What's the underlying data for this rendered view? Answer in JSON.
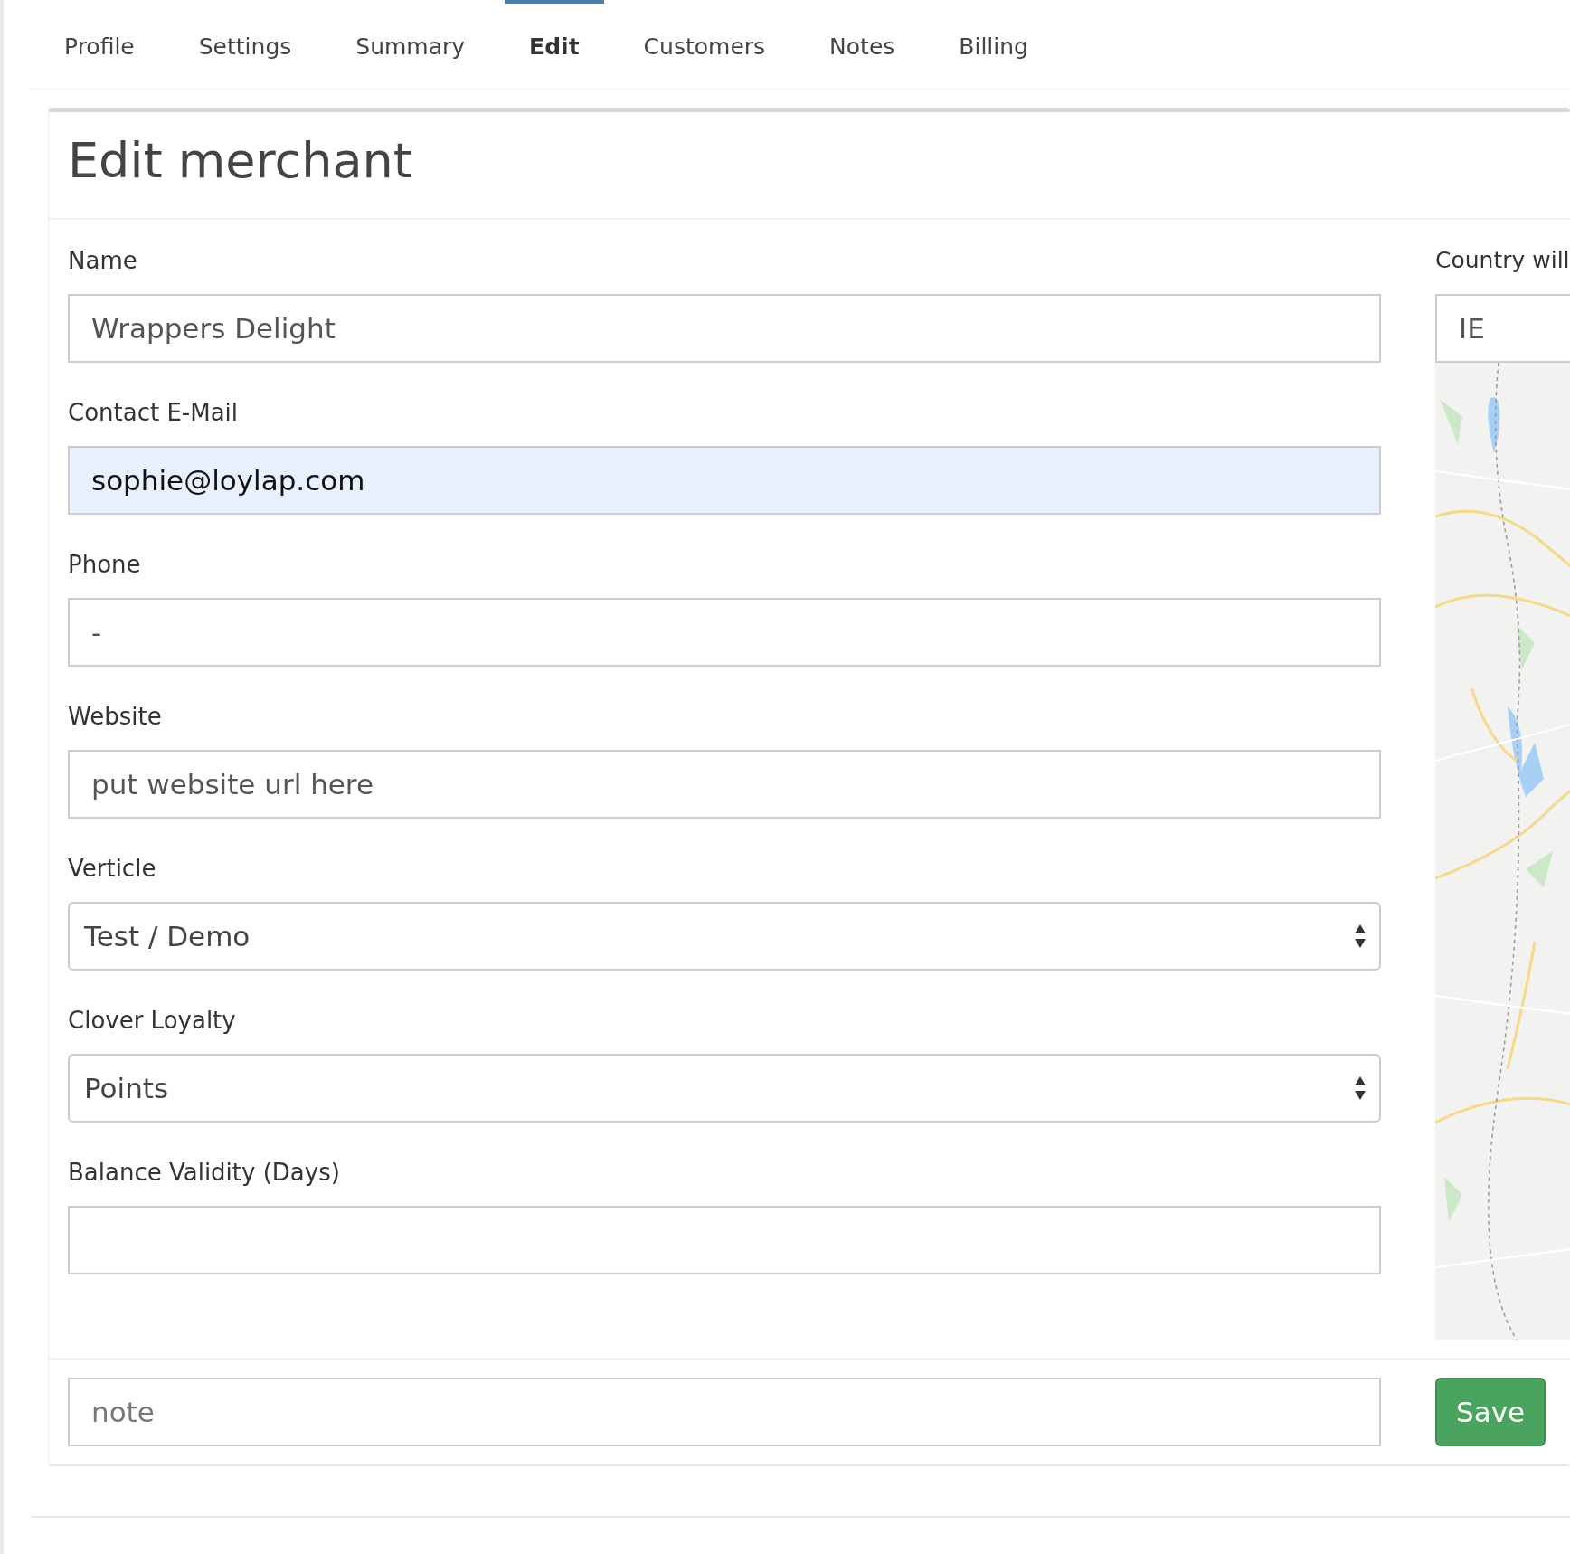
{
  "tabs": [
    {
      "label": "Profile",
      "selected": false
    },
    {
      "label": "Settings",
      "selected": false
    },
    {
      "label": "Summary",
      "selected": false
    },
    {
      "label": "Edit",
      "selected": true
    },
    {
      "label": "Customers",
      "selected": false
    },
    {
      "label": "Notes",
      "selected": false
    },
    {
      "label": "Billing",
      "selected": false
    }
  ],
  "panel": {
    "title": "Edit merchant",
    "fields": [
      {
        "kind": "text",
        "label": "Name",
        "value": "Wrappers Delight",
        "autofilled": false
      },
      {
        "kind": "text",
        "label": "Contact E-Mail",
        "value": "sophie@loylap.com",
        "autofilled": true
      },
      {
        "kind": "text",
        "label": "Phone",
        "value": "-",
        "autofilled": false
      },
      {
        "kind": "text",
        "label": "Website",
        "value": "put website url here",
        "autofilled": false
      },
      {
        "kind": "select",
        "label": "Verticle",
        "value": "Test / Demo"
      },
      {
        "kind": "select",
        "label": "Clover Loyalty",
        "value": "Points"
      },
      {
        "kind": "text",
        "label": "Balance Validity (Days)",
        "autofilled": false
      }
    ],
    "side": {
      "label": "Country will",
      "value": "IE"
    },
    "note": {
      "placeholder": "note"
    },
    "save_button": "Save"
  }
}
